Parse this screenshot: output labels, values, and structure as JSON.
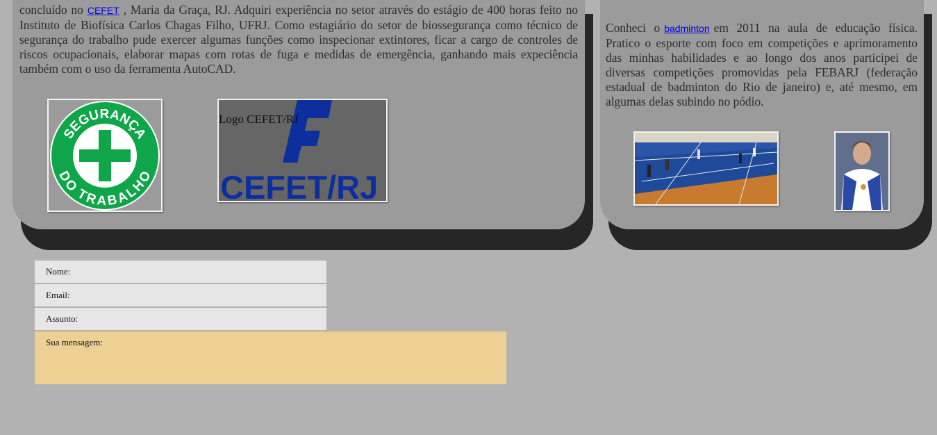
{
  "left_card": {
    "para_before": "concluído no",
    "link_label": "CEFET",
    "para_after": ", Maria da Graça, RJ. Adquiri experiência no setor através do estágio de 400 horas feito no Instituto de Biofísica Carlos Chagas Filho, UFRJ. Como estagiário do setor de biossegurança como técnico de segurança do trabalho pude exercer algumas funções como inspecionar extintores, ficar a cargo de controles de riscos ocupacionais, elaborar mapas com rotas de fuga e medidas de emergência, ganhando mais expeciência também com o uso da ferramenta AutoCAD.",
    "seguranca_logo": {
      "top_text": "SEGURANÇA",
      "bottom_text": "DO TRABALHO"
    },
    "cefet_logo": {
      "alt_text": "Logo CEFET/RJ",
      "wordmark": "CEFET/RJ"
    }
  },
  "right_card": {
    "para_before": "Conheci o",
    "link_label": "badminton",
    "para_after": "em 2011 na aula de educação física. Pratico o esporte com foco em competições e aprimoramento das minhas habilidades e ao longo dos anos participei de diversas competições promovidas pela FEBARJ (federação estadual de badminton do Rio de janeiro) e, até mesmo, em algumas delas subindo no pódio."
  },
  "form": {
    "name_label": "Nome:",
    "email_label": "Email:",
    "subject_label": "Assunto:",
    "message_label": "Sua mensagem:"
  },
  "colors": {
    "page_bg": "#b2b2b2",
    "card_bg": "#9b9b9b",
    "card_shadow": "#262626",
    "field_bg": "#e6e6e6",
    "message_bg": "#edd094",
    "link": "#0000ee",
    "logo_green": "#0fa64a",
    "cefet_blue": "#0d2f9e"
  }
}
